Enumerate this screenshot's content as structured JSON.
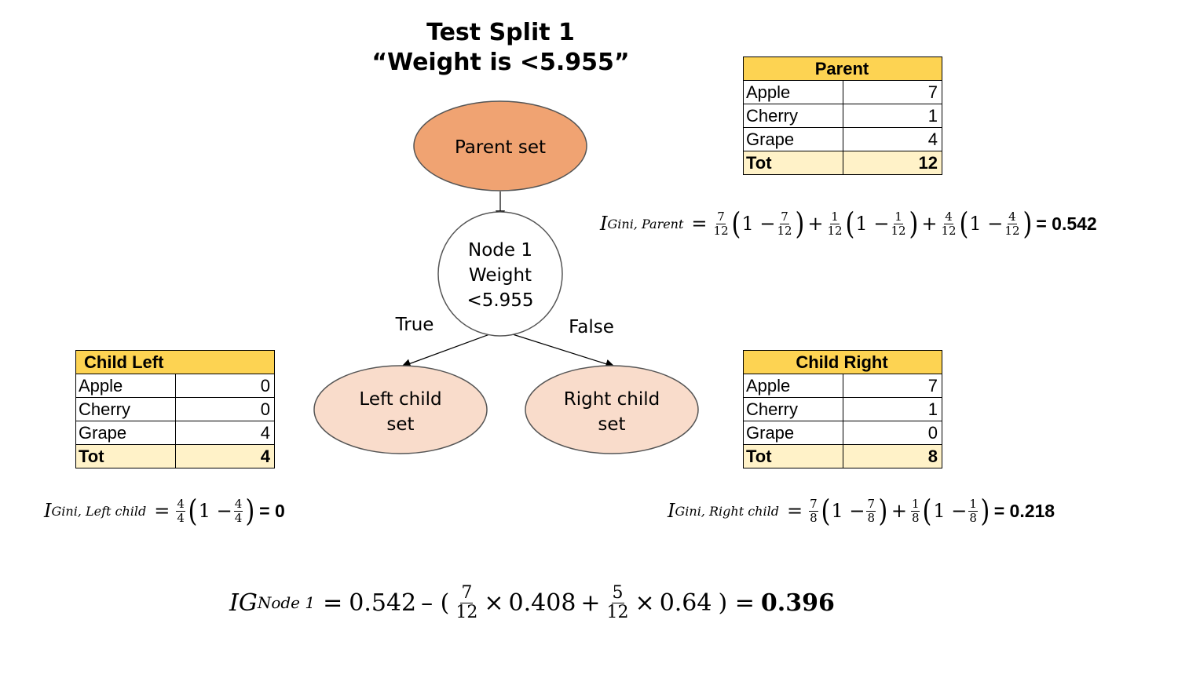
{
  "title": {
    "line1": "Test Split 1",
    "line2": "“Weight is <5.955”"
  },
  "tree": {
    "parent_node": "Parent set",
    "node1": [
      "Node 1",
      "Weight",
      "<5.955"
    ],
    "true_label": "True",
    "false_label": "False",
    "left_child": [
      "Left child",
      "set"
    ],
    "right_child": [
      "Right child",
      "set"
    ],
    "colors": {
      "parent": "#f0a372",
      "children": "#f9dccb",
      "stroke": "#555555"
    }
  },
  "tables": {
    "parent": {
      "header": "Parent",
      "rows": [
        [
          "Apple",
          "7"
        ],
        [
          "Cherry",
          "1"
        ],
        [
          "Grape",
          "4"
        ]
      ],
      "total": [
        "Tot",
        "12"
      ]
    },
    "child_left": {
      "header": "Child Left",
      "rows": [
        [
          "Apple",
          "0"
        ],
        [
          "Cherry",
          "0"
        ],
        [
          "Grape",
          "4"
        ]
      ],
      "total": [
        "Tot",
        "4"
      ]
    },
    "child_right": {
      "header": "Child Right",
      "rows": [
        [
          "Apple",
          "7"
        ],
        [
          "Cherry",
          "1"
        ],
        [
          "Grape",
          "0"
        ]
      ],
      "total": [
        "Tot",
        "8"
      ]
    },
    "colors": {
      "header": "#fdd352",
      "total": "#fff2c8"
    }
  },
  "formulas": {
    "parent": {
      "symbol": "I",
      "subscript": "Gini, Parent",
      "result": "0.542",
      "terms": [
        [
          "7",
          "12"
        ],
        [
          "1",
          "12"
        ],
        [
          "4",
          "12"
        ]
      ]
    },
    "left": {
      "symbol": "I",
      "subscript": "Gini, Left child",
      "result": "0",
      "terms": [
        [
          "4",
          "4"
        ]
      ]
    },
    "right": {
      "symbol": "I",
      "subscript": "Gini, Right child",
      "result": "0.218",
      "terms": [
        [
          "7",
          "8"
        ],
        [
          "1",
          "8"
        ]
      ]
    },
    "info_gain": {
      "symbol": "IG",
      "subscript": "Node 1",
      "parent_value": "0.542",
      "w1": [
        "7",
        "12"
      ],
      "v1": "0.408",
      "w2": [
        "5",
        "12"
      ],
      "v2": "0.64",
      "result": "0.396"
    }
  }
}
